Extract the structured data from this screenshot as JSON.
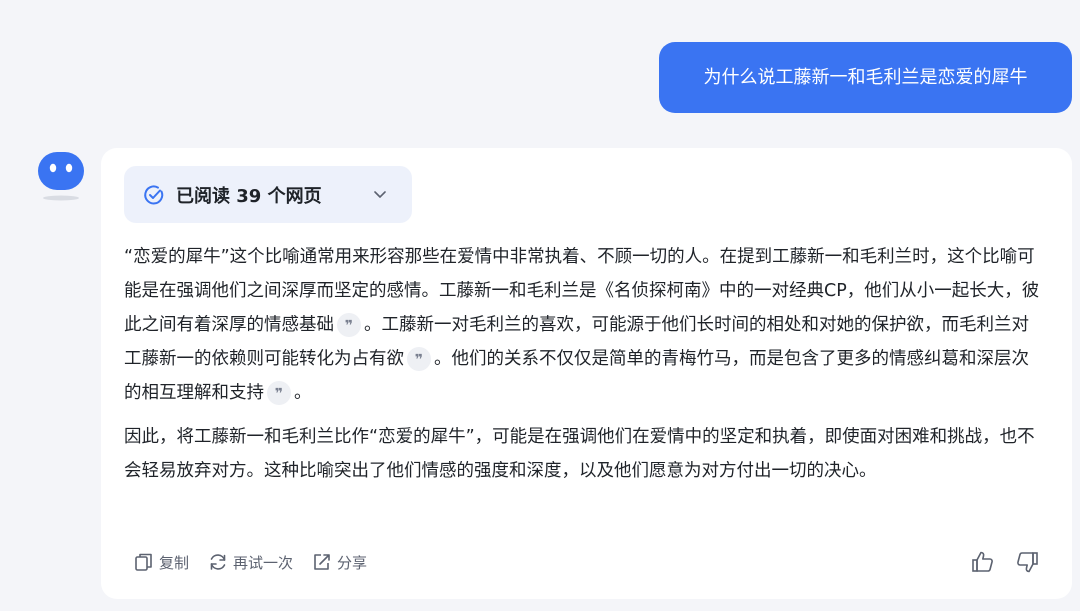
{
  "user_message": "为什么说工藤新一和毛利兰是恋爱的犀牛",
  "sources": {
    "label": "已阅读 39 个网页",
    "icon": "check-circle-icon",
    "toggle_icon": "chevron-down-icon"
  },
  "answer": {
    "p1_s1": "“恋爱的犀牛”这个比喻通常用来形容那些在爱情中非常执着、不顾一切的人。在提到工藤新一和毛利兰时，这个比喻可能是在强调他们之间深厚而坚定的感情。工藤新一和毛利兰是《名侦探柯南》中的一对经典CP，他们从小一起长大，彼此之间有着深厚的情感基础",
    "p1_s2": "。工藤新一对毛利兰的喜欢，可能源于他们长时间的相处和对她的保护欲，而毛利兰对工藤新一的依赖则可能转化为占有欲",
    "p1_s3": "。他们的关系不仅仅是简单的青梅竹马，而是包含了更多的情感纠葛和深层次的相互理解和支持",
    "p1_end": "。",
    "p2": "因此，将工藤新一和毛利兰比作“恋爱的犀牛”，可能是在强调他们在爱情中的坚定和执着，即使面对困难和挑战，也不会轻易放弃对方。这种比喻突出了他们情感的强度和深度，以及他们愿意为对方付出一切的决心。",
    "citation_glyph": "❞"
  },
  "actions": {
    "copy": "复制",
    "retry": "再试一次",
    "share": "分享"
  },
  "colors": {
    "accent": "#3a74f2",
    "background": "#f4f5f9",
    "card": "#ffffff",
    "pill": "#edf1fb"
  }
}
